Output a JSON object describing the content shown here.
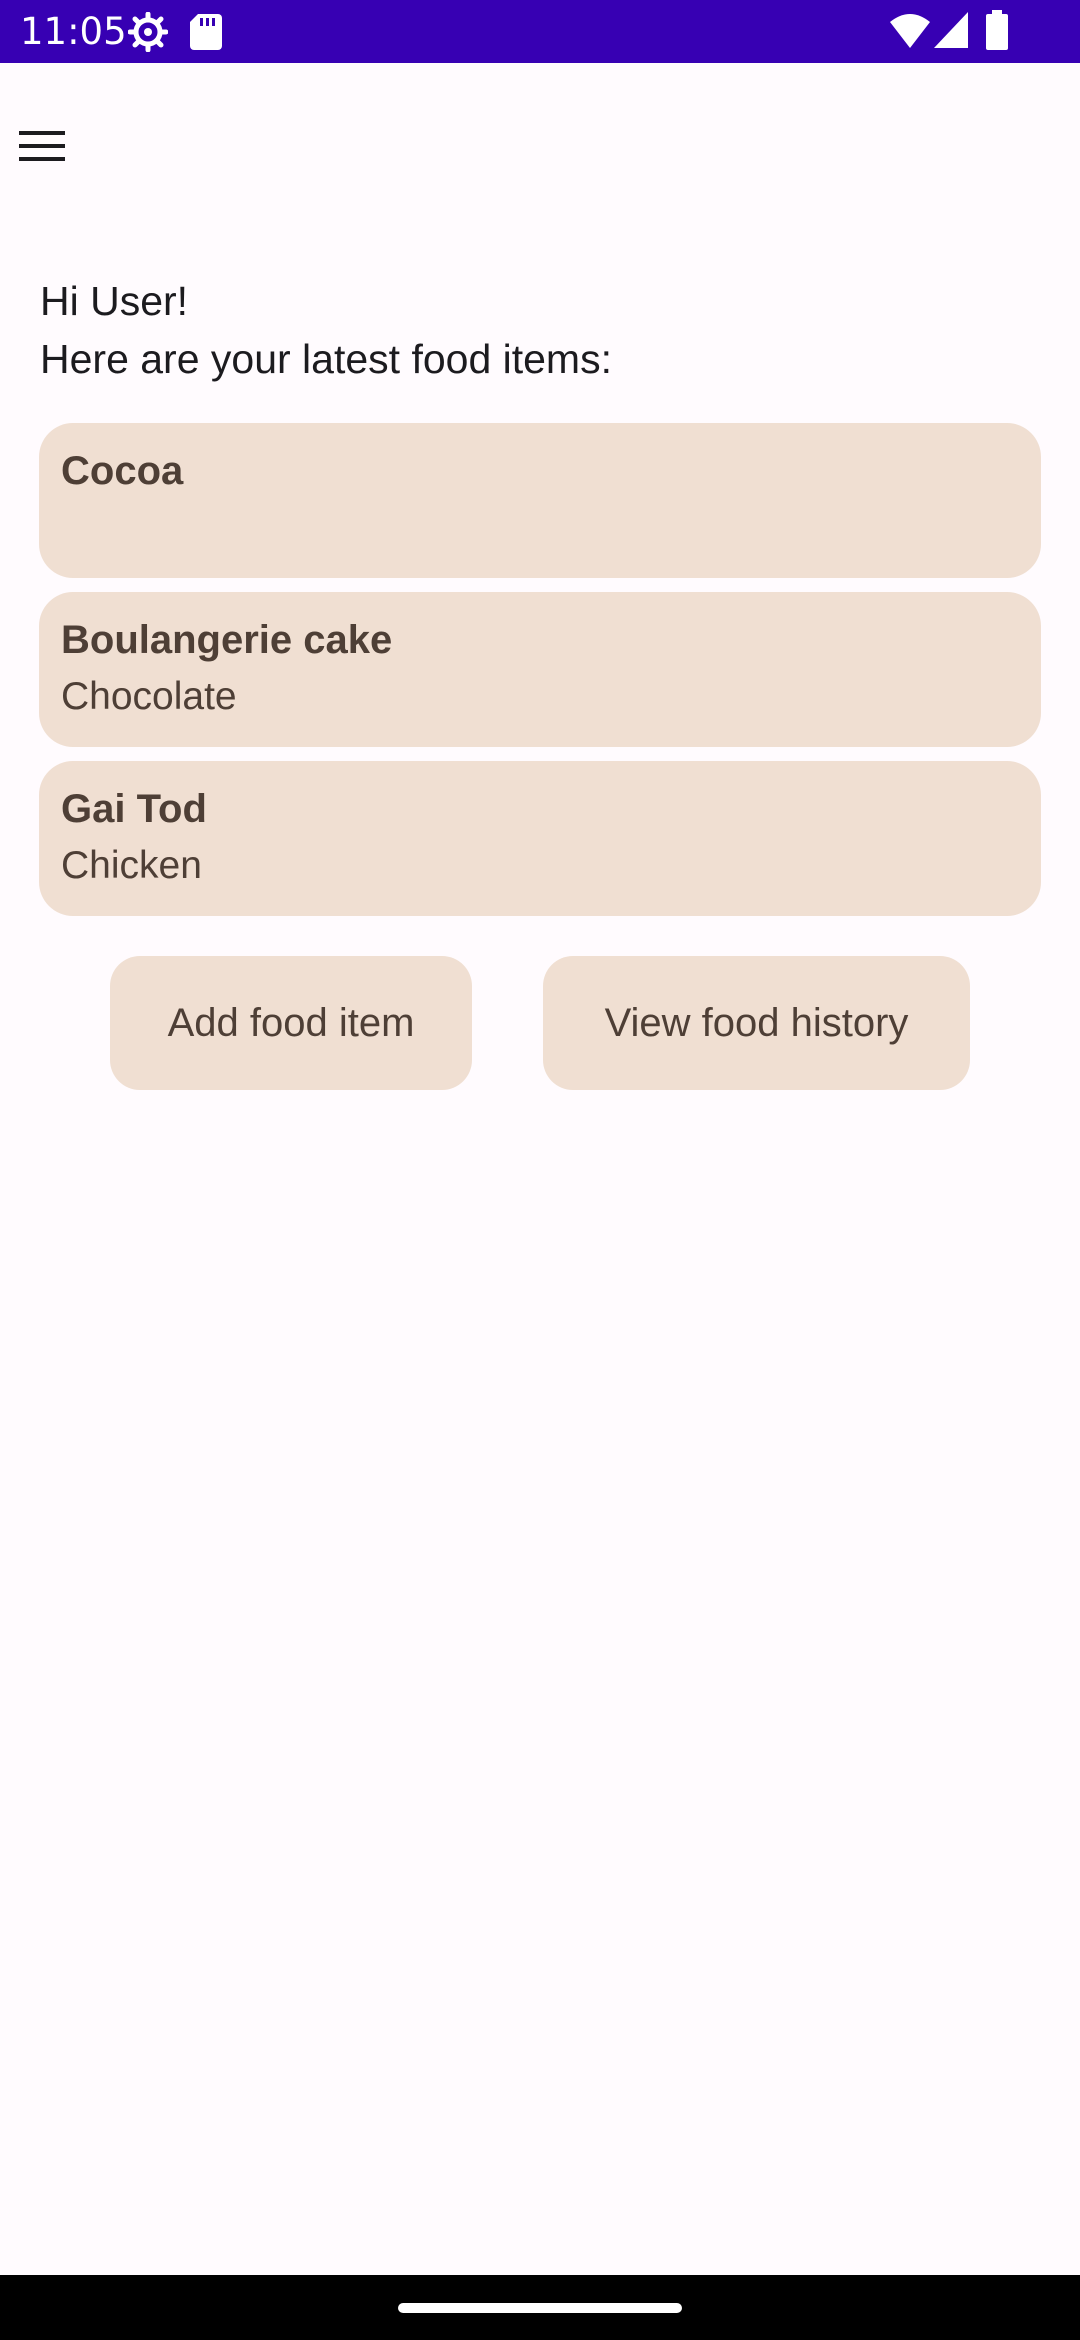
{
  "status_bar": {
    "time": "11:05",
    "icons": [
      "settings-icon",
      "sd-card-icon",
      "wifi-icon",
      "signal-icon",
      "battery-icon"
    ],
    "background": "#3700B3"
  },
  "toolbar": {
    "menu_icon": "hamburger-menu-icon"
  },
  "greeting": {
    "line1": "Hi User!",
    "line2": "Here are your latest food items:"
  },
  "food_items": [
    {
      "name": "Cocoa",
      "detail": ""
    },
    {
      "name": "Boulangerie cake",
      "detail": "Chocolate"
    },
    {
      "name": "Gai Tod",
      "detail": "Chicken"
    }
  ],
  "actions": {
    "add_label": "Add food item",
    "history_label": "View food history"
  },
  "colors": {
    "background": "#FFFBFE",
    "card": "#F0DFD2",
    "card_text": "#4E3F36"
  }
}
